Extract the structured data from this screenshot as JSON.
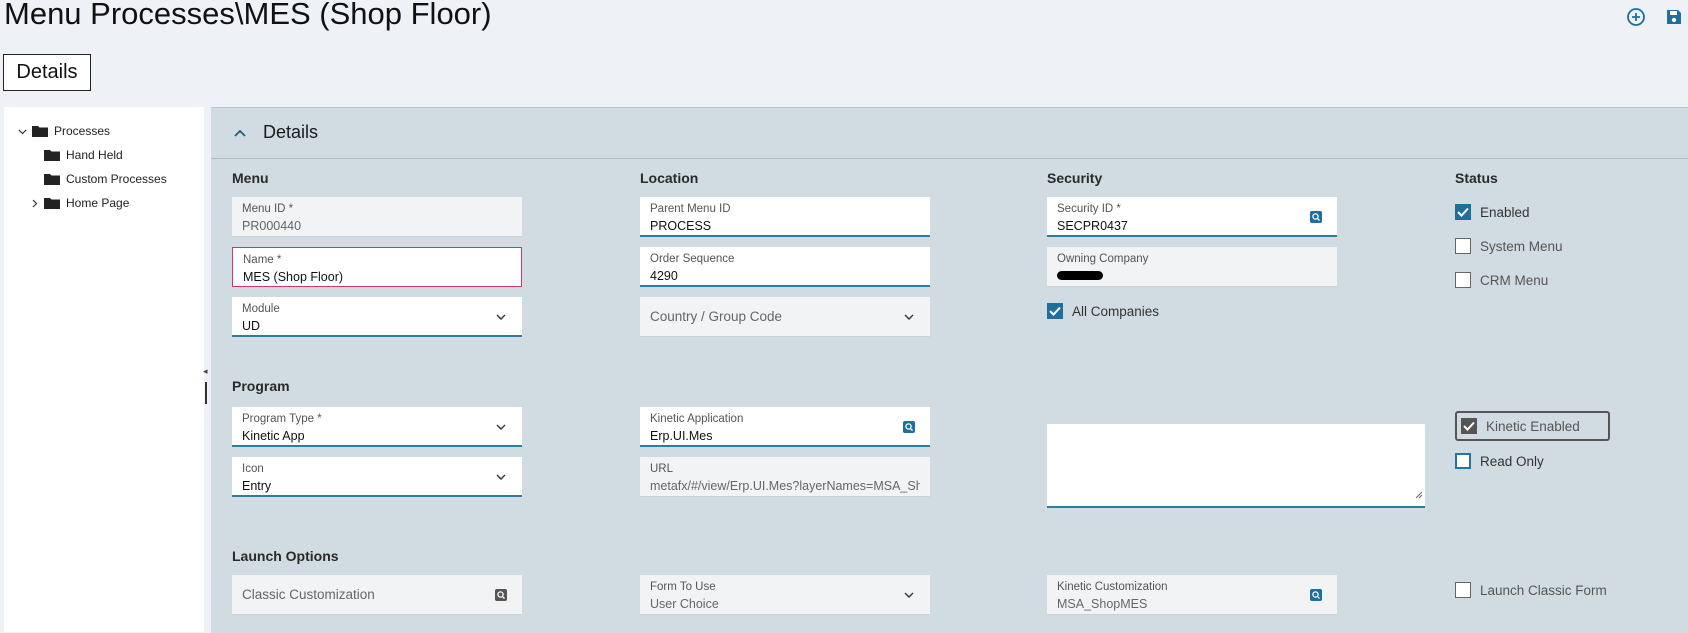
{
  "page_title": "Menu Processes\\MES (Shop Floor)",
  "toolbar": {
    "add_icon": "circle-plus-icon",
    "save_icon": "save-icon"
  },
  "tabs": [
    {
      "label": "Details"
    }
  ],
  "tree": {
    "items": [
      {
        "label": "Processes",
        "expanded": true
      },
      {
        "label": "Hand Held"
      },
      {
        "label": "Custom Processes"
      },
      {
        "label": "Home Page",
        "expandable": true
      }
    ]
  },
  "panel": {
    "title": "Details"
  },
  "sections": {
    "menu": "Menu",
    "location": "Location",
    "security": "Security",
    "status": "Status",
    "program": "Program",
    "launch": "Launch Options"
  },
  "fields": {
    "menu_id": {
      "label": "Menu ID *",
      "value": "PR000440"
    },
    "name": {
      "label": "Name *",
      "value": "MES (Shop Floor)"
    },
    "module": {
      "label": "Module",
      "value": "UD"
    },
    "parent_menu_id": {
      "label": "Parent Menu ID",
      "value": "PROCESS"
    },
    "order_sequence": {
      "label": "Order Sequence",
      "value": "4290"
    },
    "country_group": {
      "placeholder": "Country / Group Code"
    },
    "security_id": {
      "label": "Security ID *",
      "value": "SECPR0437"
    },
    "owning_company": {
      "label": "Owning Company",
      "value": ""
    },
    "program_type": {
      "label": "Program Type *",
      "value": "Kinetic App"
    },
    "icon": {
      "label": "Icon",
      "value": "Entry"
    },
    "kinetic_application": {
      "label": "Kinetic Application",
      "value": "Erp.UI.Mes"
    },
    "url": {
      "label": "URL",
      "value": "metafx/#/view/Erp.UI.Mes?layerNames=MSA_ShopMES"
    },
    "description": {
      "value": ""
    },
    "classic_customization": {
      "placeholder": "Classic Customization"
    },
    "form_to_use": {
      "label": "Form To Use",
      "value": "User Choice"
    },
    "kinetic_customization": {
      "label": "Kinetic Customization",
      "value": "MSA_ShopMES"
    }
  },
  "checkboxes": {
    "all_companies": {
      "label": "All Companies",
      "checked": true
    },
    "enabled": {
      "label": "Enabled",
      "checked": true
    },
    "system_menu": {
      "label": "System Menu",
      "checked": false
    },
    "crm_menu": {
      "label": "CRM Menu",
      "checked": false
    },
    "kinetic_enabled": {
      "label": "Kinetic Enabled",
      "checked": true
    },
    "read_only": {
      "label": "Read Only",
      "checked": false
    },
    "launch_classic_form": {
      "label": "Launch Classic Form",
      "checked": false
    }
  },
  "colors": {
    "accent": "#1f6f9e",
    "panel_bg": "#d0dce2",
    "error_border": "#c9367a"
  }
}
